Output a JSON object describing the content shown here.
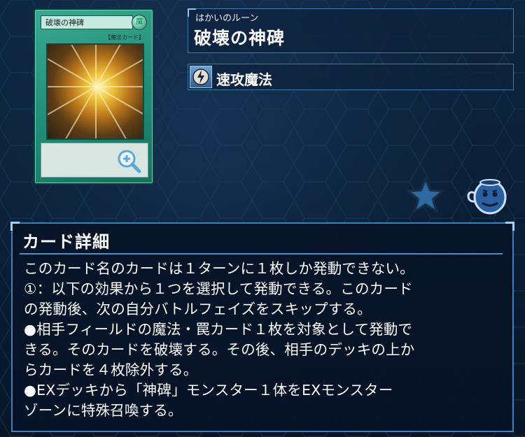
{
  "card": {
    "thumb_name": "破壊の神碑",
    "thumb_type": "【魔法カード】",
    "zoom_icon": "zoom-in-icon"
  },
  "title": {
    "reading": "はかいのルーン",
    "name": "破壊の神碑"
  },
  "spell_type": {
    "icon": "quick-play-icon",
    "label": "速攻魔法"
  },
  "actions": {
    "star_icon": "star-icon",
    "pot_icon": "pot-of-greed-icon"
  },
  "detail": {
    "heading": "カード詳細",
    "text": "このカード名のカードは１ターンに１枚しか発動できない。\n①：以下の効果から１つを選択して発動できる。このカード\nの発動後、次の自分バトルフェイズをスキップする。\n●相手フィールドの魔法・罠カード１枚を対象として発動で\nきる。そのカードを破壊する。その後、相手のデッキの上か\nらカードを４枚除外する。\n●EXデッキから「神碑」モンスター１体をEXモンスター\nゾーンに特殊召喚する。"
  },
  "colors": {
    "background": "#0a1d33",
    "panel_border": "#3f7fb8",
    "spell_card": "#1f8a74"
  }
}
